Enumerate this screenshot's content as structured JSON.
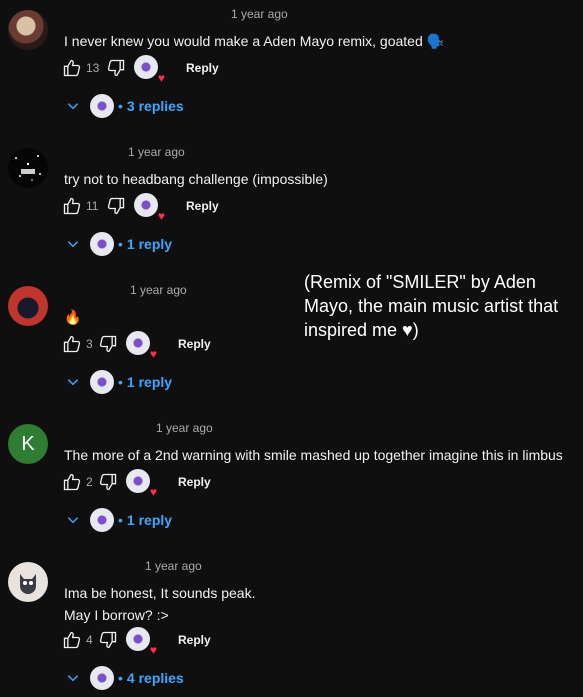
{
  "comments": [
    {
      "time": "1 year ago",
      "lines": [
        "I never knew you would make a Aden Mayo remix, goated 🗣️"
      ],
      "likes": "13",
      "reply_label": "Reply",
      "replies_label": "3 replies",
      "avatar_icon": "user-avatar-icon"
    },
    {
      "time": "1 year ago",
      "lines": [
        "try not to headbang challenge (impossible)"
      ],
      "likes": "11",
      "reply_label": "Reply",
      "replies_label": "1 reply",
      "avatar_icon": "user-avatar-icon"
    },
    {
      "time": "1 year ago",
      "lines": [
        "🔥"
      ],
      "likes": "3",
      "reply_label": "Reply",
      "replies_label": "1 reply",
      "avatar_icon": "user-avatar-icon"
    },
    {
      "time": "1 year ago",
      "lines": [
        "The more of a 2nd warning with smile mashed up together imagine this in limbus"
      ],
      "likes": "2",
      "reply_label": "Reply",
      "replies_label": "1 reply",
      "avatar_letter": "K"
    },
    {
      "time": "1 year ago",
      "lines": [
        "Ima be honest, It sounds peak.",
        "May I borrow? :>"
      ],
      "likes": "4",
      "reply_label": "Reply",
      "replies_label": "4 replies",
      "avatar_icon": "user-avatar-icon"
    }
  ],
  "overlay_text": "(Remix of \"SMILER\" by Aden Mayo, the main music artist that inspired me ♥)",
  "colors": {
    "background": "#0f0f0f",
    "link": "#3ea6ff",
    "secondary_text": "#aaaaaa",
    "heart": "#ff2f4b"
  }
}
